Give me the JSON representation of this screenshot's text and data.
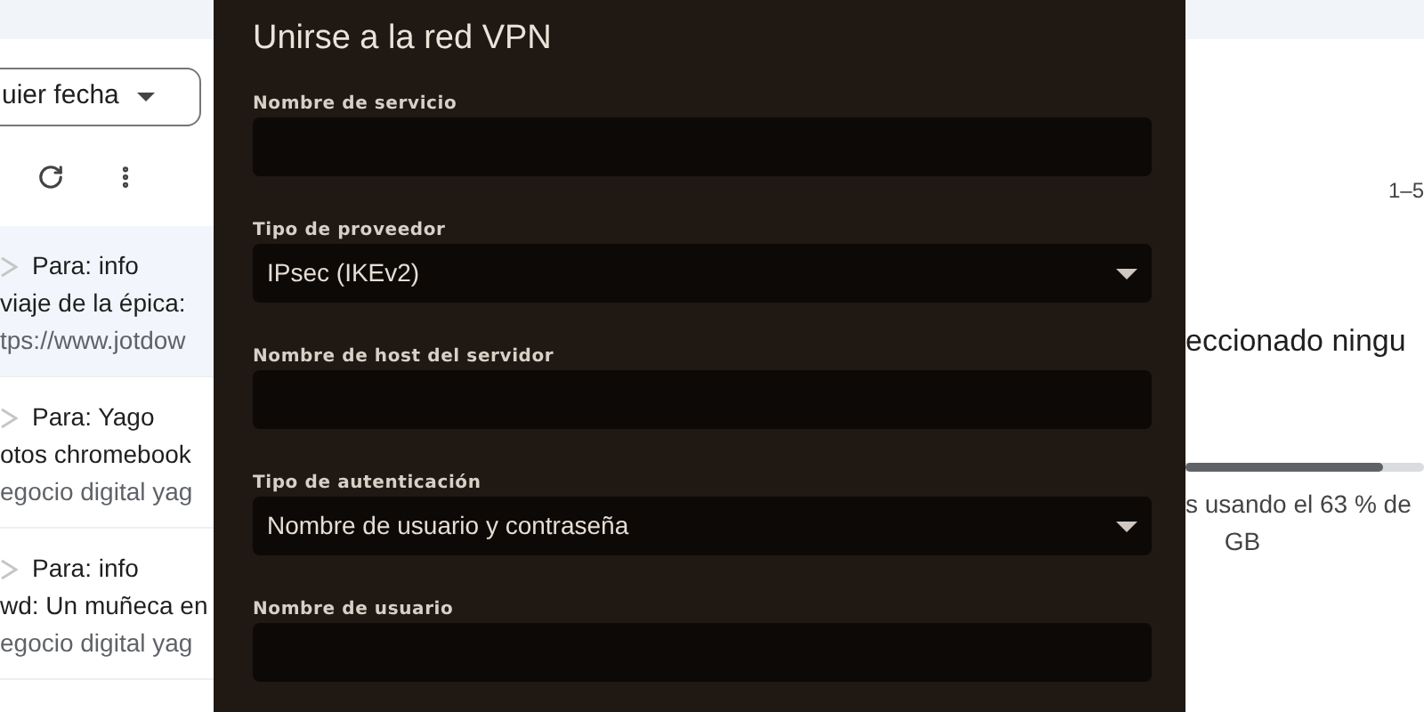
{
  "mail_list": {
    "date_filter": "uier fecha",
    "messages": [
      {
        "to": "Para: info",
        "subject": "viaje de la épica:",
        "snippet": "tps://www.jotdow",
        "selected": true
      },
      {
        "to": "Para: Yago",
        "subject": "otos chromebook",
        "snippet": "egocio digital yag",
        "selected": false
      },
      {
        "to": "Para: info",
        "subject": "wd: Un muñeca en",
        "snippet": "egocio digital yag",
        "selected": false
      }
    ]
  },
  "dialog": {
    "title": "Unirse a la red VPN",
    "fields": [
      {
        "kind": "text",
        "label": "Nombre de servicio"
      },
      {
        "kind": "select",
        "label": "Tipo de proveedor",
        "value": "IPsec (IKEv2)"
      },
      {
        "kind": "text",
        "label": "Nombre de host del servidor"
      },
      {
        "kind": "select",
        "label": "Tipo de autenticación",
        "value": "Nombre de usuario y contraseña"
      },
      {
        "kind": "text",
        "label": "Nombre de usuario"
      }
    ]
  },
  "right_panel": {
    "page_range": "1–5",
    "empty_message": "eccionado ningu",
    "storage": {
      "level": 0.83,
      "text": "s usando el 63 % de",
      "unit": "GB"
    }
  }
}
